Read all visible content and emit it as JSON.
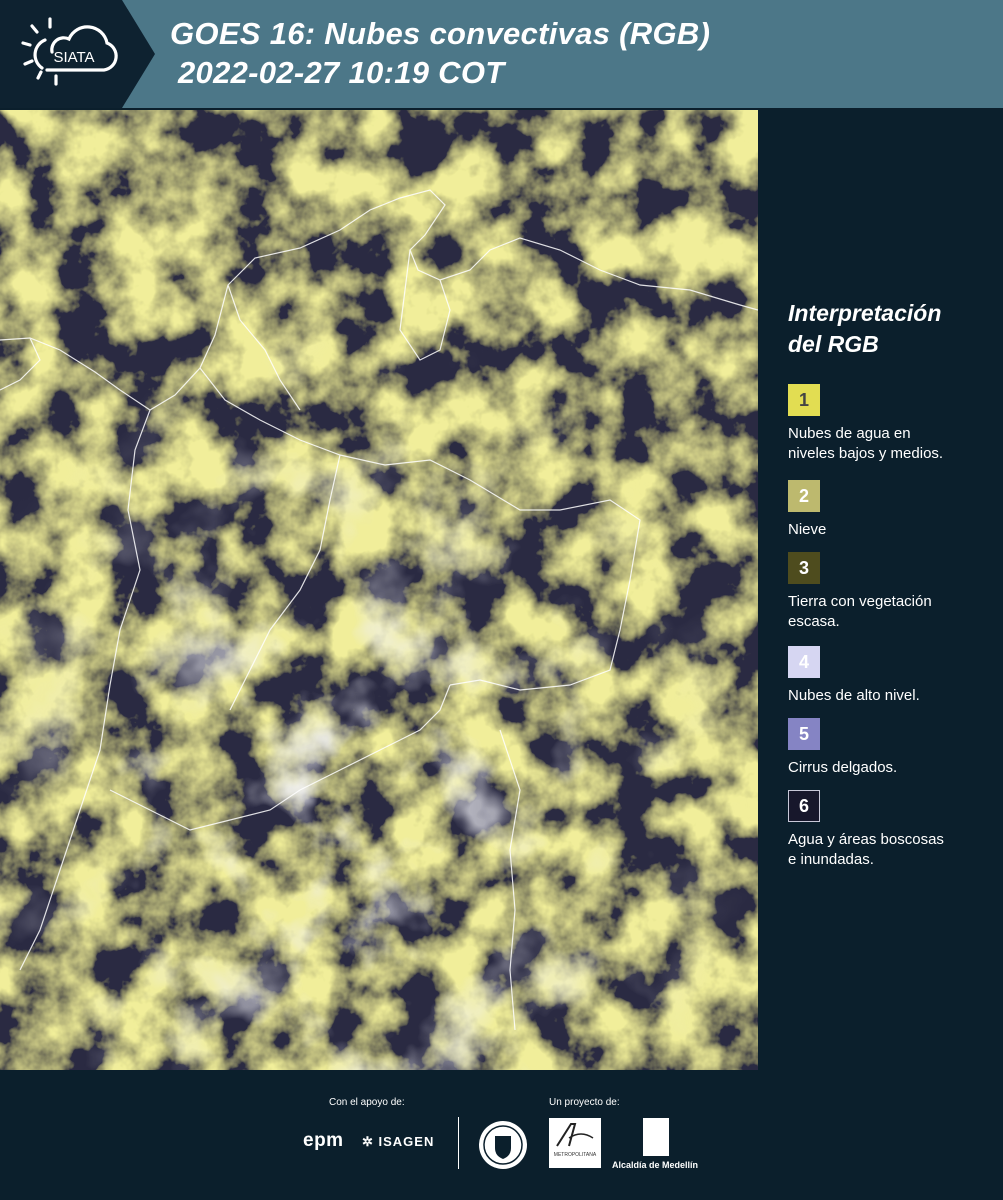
{
  "header": {
    "logo_text": "SIATA",
    "title_line1": "GOES 16: Nubes convectivas (RGB)",
    "title_line2": "2022-02-27 10:19 COT"
  },
  "legend": {
    "title_line1": "Interpretación",
    "title_line2": "del RGB",
    "items": [
      {
        "number": "1",
        "color": "#e2dd52",
        "text_color": "#444444",
        "lines": [
          "Nubes de agua en",
          "niveles bajos y medios."
        ]
      },
      {
        "number": "2",
        "color": "#bdb96e",
        "text_color": "#ffffff",
        "lines": [
          "Nieve"
        ]
      },
      {
        "number": "3",
        "color": "#4e4c1e",
        "text_color": "#ffffff",
        "lines": [
          "Tierra con vegetación",
          "escasa."
        ]
      },
      {
        "number": "4",
        "color": "#d6d6f2",
        "text_color": "#ffffff",
        "lines": [
          "Nubes de alto nivel."
        ]
      },
      {
        "number": "5",
        "color": "#8584c4",
        "text_color": "#ffffff",
        "lines": [
          "Cirrus delgados."
        ]
      },
      {
        "number": "6",
        "color": "#17172b",
        "text_color": "#ffffff",
        "lines": [
          "Agua y áreas boscosas",
          "e inundadas."
        ]
      }
    ]
  },
  "footer": {
    "support_label": "Con el apoyo de:",
    "project_label": "Un proyecto de:",
    "epm": "epm",
    "isagen": "ISAGEN",
    "area_label": "METROPOLITANA",
    "alcaldia": "Alcaldía de Medellín"
  }
}
